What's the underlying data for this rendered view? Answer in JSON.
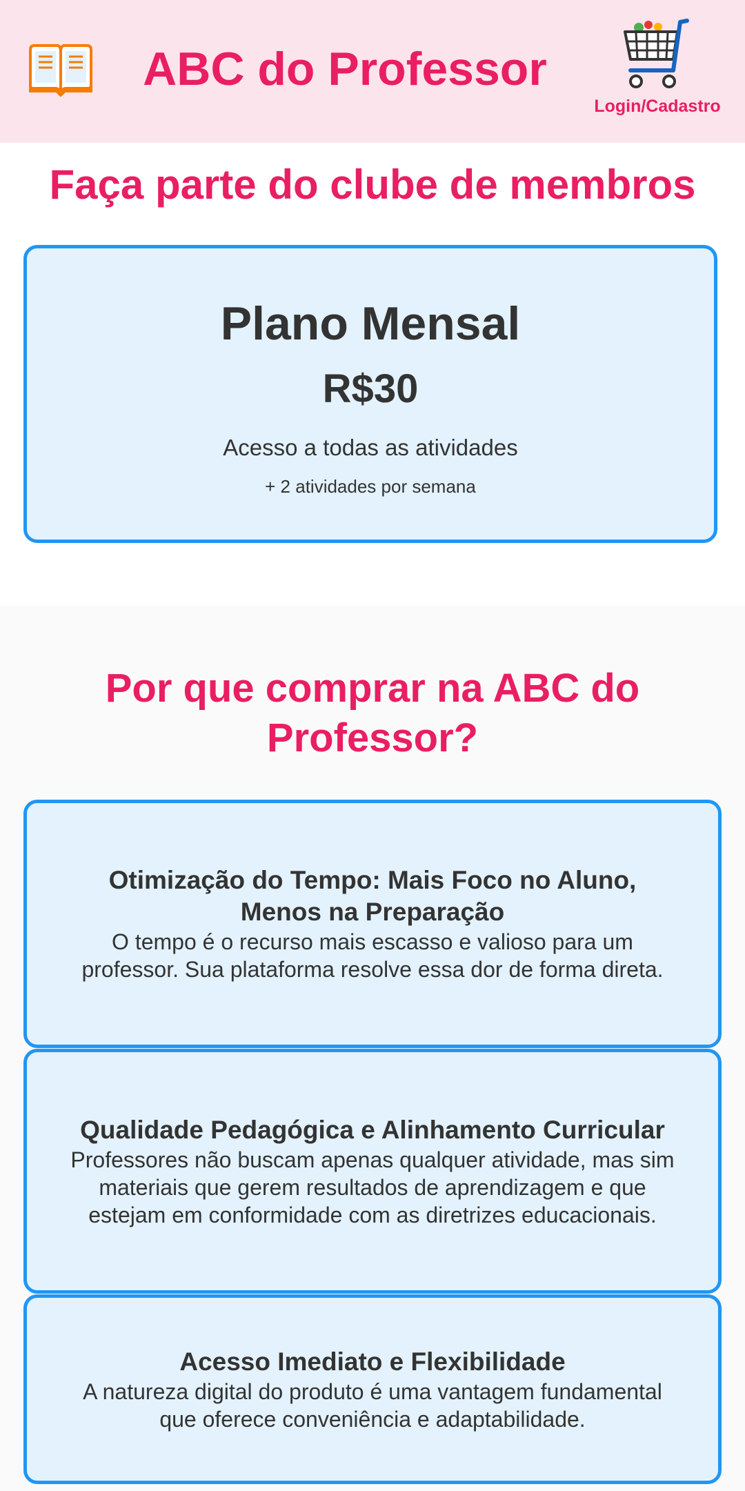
{
  "header": {
    "title": "ABC do Professor",
    "login_label": "Login/Cadastro",
    "logo_icon": "open-book-icon",
    "cart_icon": "shopping-cart-icon"
  },
  "club": {
    "title": "Faça parte do clube de membros",
    "plan": {
      "name": "Plano Mensal",
      "price": "R$30",
      "description": "Acesso a todas as atividades",
      "extra": "+ 2 atividades por semana"
    }
  },
  "why": {
    "title": "Por que comprar na ABC do Professor?",
    "benefits": [
      {
        "heading": "Otimização do Tempo: Mais Foco no Aluno, Menos na Preparação",
        "text": "O tempo é o recurso mais escasso e valioso para um professor. Sua plataforma resolve essa dor de forma direta."
      },
      {
        "heading": "Qualidade Pedagógica e Alinhamento Curricular",
        "text": "Professores não buscam apenas qualquer atividade, mas sim materiais que gerem resultados de aprendizagem e que estejam em conformidade com as diretrizes educacionais."
      },
      {
        "heading": "Acesso Imediato e Flexibilidade",
        "text": "A natureza digital do produto é uma vantagem fundamental que oferece conveniência e adaptabilidade."
      }
    ]
  },
  "colors": {
    "brand_pink": "#e91e63",
    "header_bg": "#fce4ec",
    "card_border": "#2196f3",
    "card_bg": "#e3f2fd"
  }
}
